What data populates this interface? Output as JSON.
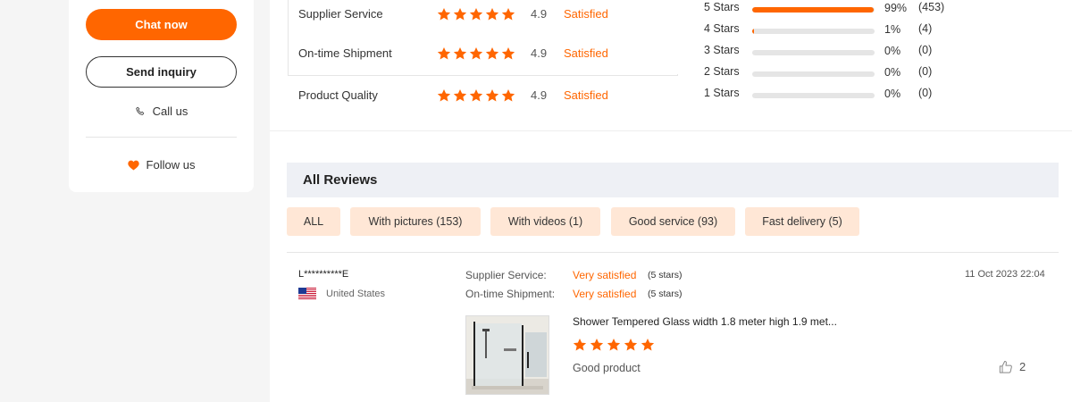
{
  "sidebar": {
    "chat_label": "Chat now",
    "inquiry_label": "Send inquiry",
    "call_label": "Call us",
    "follow_label": "Follow us"
  },
  "ratings": [
    {
      "label": "Supplier Service",
      "score": "4.9",
      "status": "Satisfied",
      "stars": 5
    },
    {
      "label": "On-time Shipment",
      "score": "4.9",
      "status": "Satisfied",
      "stars": 5
    },
    {
      "label": "Product Quality",
      "score": "4.9",
      "status": "Satisfied",
      "stars": 5
    }
  ],
  "distribution": [
    {
      "label": "5 Stars",
      "percent": "99%",
      "count": "(453)",
      "fill": 0.99
    },
    {
      "label": "4 Stars",
      "percent": "1%",
      "count": "(4)",
      "fill": 0.01
    },
    {
      "label": "3 Stars",
      "percent": "0%",
      "count": "(0)",
      "fill": 0
    },
    {
      "label": "2 Stars",
      "percent": "0%",
      "count": "(0)",
      "fill": 0
    },
    {
      "label": "1 Stars",
      "percent": "0%",
      "count": "(0)",
      "fill": 0
    }
  ],
  "reviews_section": {
    "title": "All Reviews",
    "filters": [
      "ALL",
      "With pictures (153)",
      "With videos (1)",
      "Good service (93)",
      "Fast delivery (5)"
    ]
  },
  "review": {
    "user": "L**********E",
    "country": "United States",
    "supplier_label": "Supplier Service:",
    "supplier_value": "Very satisfied",
    "supplier_stars": "(5 stars)",
    "shipment_label": "On-time Shipment:",
    "shipment_value": "Very satisfied",
    "shipment_stars": "(5 stars)",
    "date": "11 Oct 2023 22:04",
    "product_title": "Shower Tempered Glass width 1.8 meter high 1.9 met...",
    "rating": 5,
    "comment": "Good product",
    "likes": "2"
  },
  "colors": {
    "accent": "#ff6600",
    "filter_bg": "#ffe7d6",
    "header_bg": "#eef0f5"
  }
}
